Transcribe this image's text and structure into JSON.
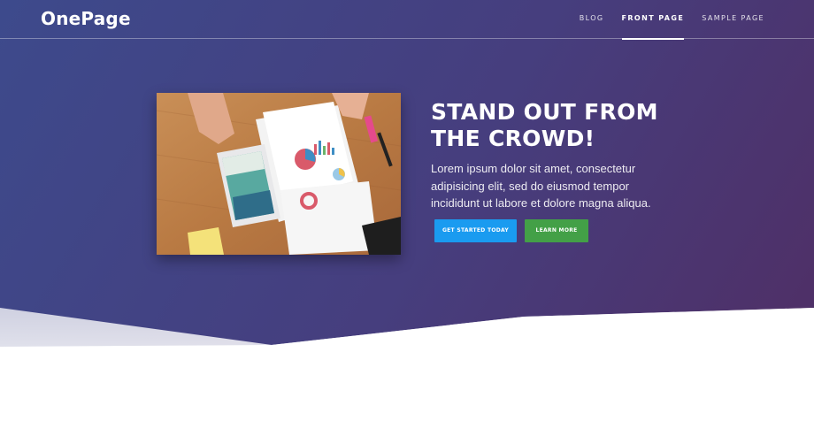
{
  "colors": {
    "hero_gradient": [
      "#3d4a8c",
      "#463e7e",
      "#4f2f66"
    ],
    "primary_button": "#1a9bf0",
    "secondary_button": "#43a047",
    "text": "#ffffff"
  },
  "header": {
    "logo": "OnePage",
    "nav": [
      {
        "label": "BLOG",
        "active": false
      },
      {
        "label": "FRONT PAGE",
        "active": true
      },
      {
        "label": "SAMPLE PAGE",
        "active": false
      }
    ]
  },
  "hero": {
    "image_icon": "desk-tablet-charts-photo",
    "headline_lines": [
      "STAND OUT FROM",
      "THE CROWD!"
    ],
    "lead": "Lorem ipsum dolor sit amet, consectetur adipisicing elit, sed do eiusmod tempor incididunt ut labore et dolore magna aliqua.",
    "primary_button": "GET STARTED TODAY",
    "secondary_button": "LEARN MORE"
  }
}
